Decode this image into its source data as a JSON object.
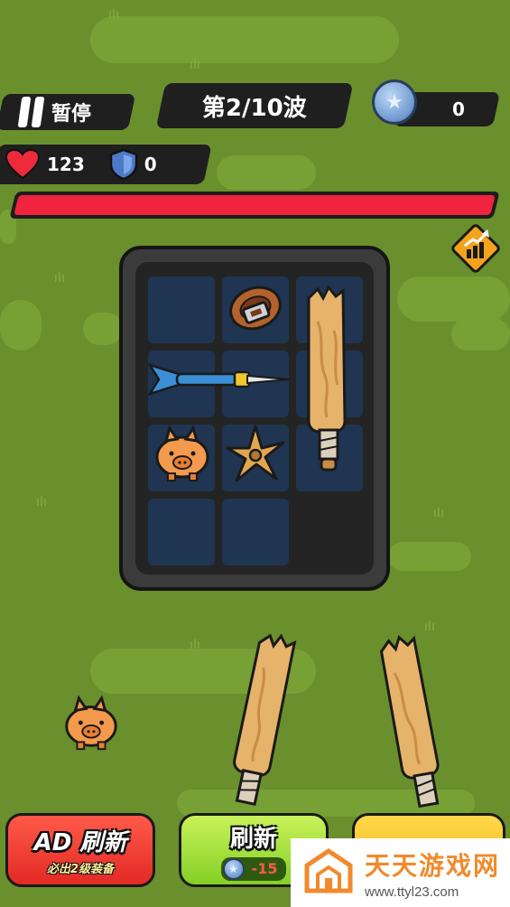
{
  "hud": {
    "pause_label": "暂停",
    "wave_label": "第2/10波",
    "coins": "0",
    "health": "123",
    "armor": "0"
  },
  "health_bar": {
    "fill_fraction": 1.0,
    "color": "#f0243e"
  },
  "inventory": {
    "slots": [
      {
        "item": "belt-icon"
      },
      {
        "item": "wooden-club-icon"
      },
      {
        "item": "dart-icon"
      },
      {
        "item": "piggy-bank-icon"
      },
      {
        "item": "shuriken-icon"
      }
    ]
  },
  "field_items": [
    "piggy-bank",
    "wooden-club",
    "wooden-club"
  ],
  "buttons": {
    "ad_refresh_label": "AD 刷新",
    "ad_refresh_sub": "必出2级装备",
    "refresh_label": "刷新",
    "refresh_cost": "-15"
  },
  "watermark": {
    "title": "天天游戏网",
    "url": "www.ttyl23.com"
  },
  "colors": {
    "background": "#6a8f2d",
    "health_red": "#f0243e",
    "ad_button": "#e22a24",
    "refresh_button": "#84cf26",
    "third_button": "#f5b51c"
  }
}
